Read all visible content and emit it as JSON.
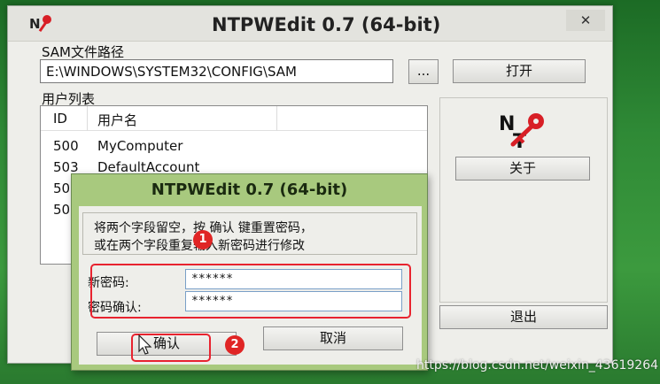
{
  "window": {
    "title": "NTPWEdit 0.7 (64-bit)",
    "close_glyph": "✕"
  },
  "sam": {
    "group_label": "SAM文件路径",
    "path_value": "E:\\WINDOWS\\SYSTEM32\\CONFIG\\SAM",
    "browse_label": "...",
    "open_label": "打开"
  },
  "users": {
    "group_label": "用户列表",
    "columns": [
      "ID",
      "用户名"
    ],
    "rows": [
      {
        "id": "500",
        "name": "MyComputer"
      },
      {
        "id": "503",
        "name": "DefaultAccount"
      },
      {
        "id": "50",
        "name": ""
      },
      {
        "id": "50",
        "name": ""
      }
    ]
  },
  "side": {
    "about_label": "关于",
    "exit_label": "退出"
  },
  "dialog": {
    "title": "NTPWEdit 0.7 (64-bit)",
    "message_line1": "将两个字段留空，按 确认 键重置密码，",
    "message_line2": "或在两个字段重复输入新密码进行修改",
    "new_password_label": "新密码:",
    "new_password_value": "******",
    "confirm_password_label": "密码确认:",
    "confirm_password_value": "******",
    "ok_label": "确认",
    "cancel_label": "取消"
  },
  "annotations": {
    "step1": "1",
    "step2": "2",
    "color": "#e8232f"
  },
  "watermark": "https://blog.csdn.net/weixin_43619264",
  "colors": {
    "desktop": "#2f8a36",
    "dialog_frame": "#a8c97e",
    "window_bg": "#eeeeea",
    "key_icon": "#d81f26"
  }
}
